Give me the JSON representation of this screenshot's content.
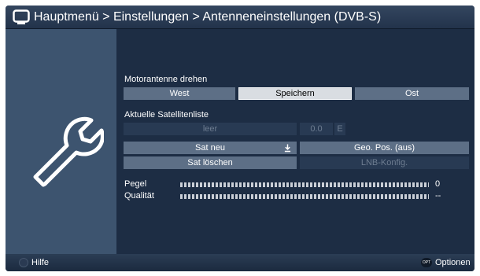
{
  "header": {
    "title": "Hauptmenü > Einstellungen > Antenneneinstellungen (DVB-S)"
  },
  "motor": {
    "label": "Motorantenne drehen",
    "west": "West",
    "save": "Speichern",
    "east": "Ost"
  },
  "satlist": {
    "label": "Aktuelle Satellitenliste",
    "name": "leer",
    "position": "0.0",
    "direction": "E"
  },
  "actions": {
    "new_sat": "Sat neu",
    "geo_pos": "Geo. Pos. (aus)",
    "delete_sat": "Sat löschen",
    "lnb_config": "LNB-Konfig."
  },
  "signal": {
    "level_label": "Pegel",
    "level_value": "0",
    "quality_label": "Qualität",
    "quality_value": "--"
  },
  "footer": {
    "help": "Hilfe",
    "opt_badge": "OPT",
    "options": "Optionen"
  },
  "icons": {
    "header": "tv-icon",
    "side": "wrench-icon",
    "download": "download-arrow-icon"
  },
  "colors": {
    "background": "#1d2d44",
    "side_panel": "#3d546f",
    "button": "#5d6f86",
    "selected_button": "#d9dde2",
    "disabled_button": "#283a53"
  }
}
